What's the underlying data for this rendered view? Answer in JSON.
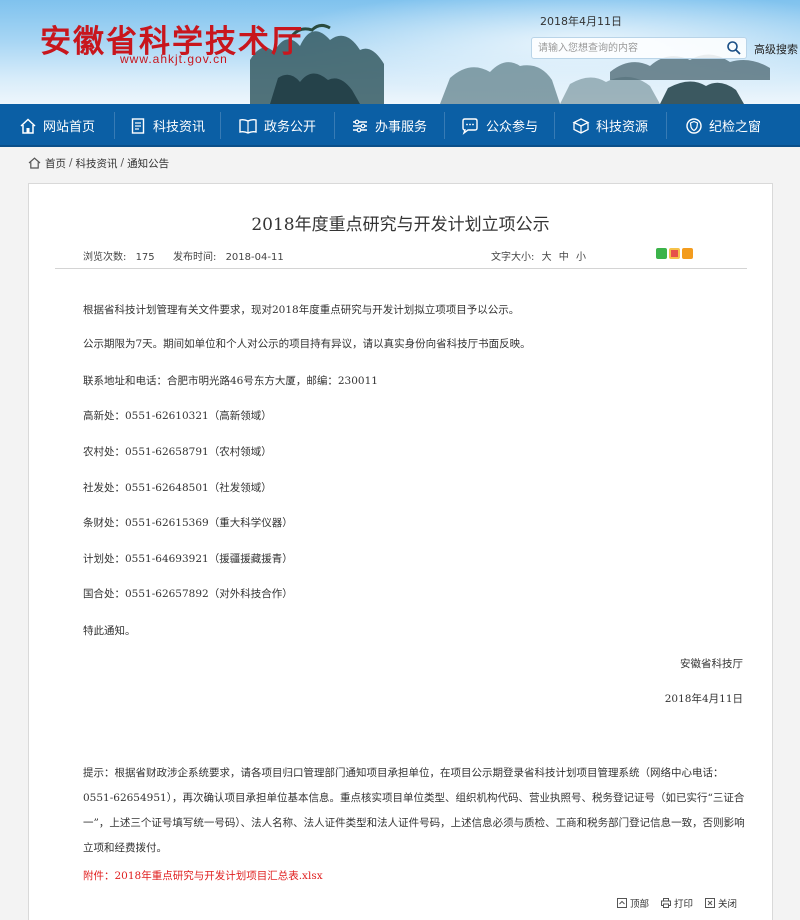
{
  "header": {
    "title": "安徽省科学技术厅",
    "url": "www.ahkjt.gov.cn",
    "date": "2018年4月11日",
    "search_placeholder": "请输入您想查询的内容",
    "advanced_search": "高级搜索"
  },
  "nav": {
    "items": [
      {
        "label": "网站首页",
        "icon": "home-icon"
      },
      {
        "label": "科技资讯",
        "icon": "news-icon"
      },
      {
        "label": "政务公开",
        "icon": "book-icon"
      },
      {
        "label": "办事服务",
        "icon": "service-icon"
      },
      {
        "label": "公众参与",
        "icon": "chat-icon"
      },
      {
        "label": "科技资源",
        "icon": "box-icon"
      },
      {
        "label": "纪检之窗",
        "icon": "shield-icon"
      }
    ]
  },
  "breadcrumb": [
    "首页",
    "科技资讯",
    "通知公告"
  ],
  "article": {
    "title": "2018年度重点研究与开发计划立项公示",
    "views_label": "浏览次数:",
    "views": "175",
    "pubtime_label": "发布时间:",
    "pubtime": "2018-04-11",
    "fontsize_label": "文字大小:",
    "fontsize_options": [
      "大",
      "中",
      "小"
    ],
    "paragraphs": [
      "根据省科技计划管理有关文件要求，现对2018年度重点研究与开发计划拟立项项目予以公示。",
      "公示期限为7天。期间如单位和个人对公示的项目持有异议，请以真实身份向省科技厅书面反映。",
      "联系地址和电话：合肥市明光路46号东方大厦，邮编：230011",
      "高新处：0551-62610321（高新领域）",
      "农村处：0551-62658791（农村领域）",
      "社发处：0551-62648501（社发领域）",
      "条财处：0551-62615369（重大科学仪器）",
      "计划处：0551-64693921（援疆援藏援青）",
      "国合处：0551-62657892（对外科技合作）",
      "特此通知。"
    ],
    "signature": "安徽省科技厅",
    "sign_date": "2018年4月11日",
    "notice": "提示：根据省财政涉企系统要求，请各项目归口管理部门通知项目承担单位，在项目公示期登录省科技计划项目管理系统（网络中心电话：0551-62654951），再次确认项目承担单位基本信息。重点核实项目单位类型、组织机构代码、营业执照号、税务登记证号（如已实行“三证合一”，上述三个证号填写统一号码）、法人名称、法人证件类型和法人证件号码，上述信息必须与质检、工商和税务部门登记信息一致，否则影响立项和经费拨付。",
    "attachment_prefix": "附件：",
    "attachment_link": "2018年重点研究与开发计划项目汇总表.xlsx"
  },
  "tools": {
    "top": "顶部",
    "print": "打印",
    "close": "关闭"
  },
  "colors": {
    "brand_red": "#c8161d",
    "nav_blue": "#0b5fa5",
    "attachment_red": "#e02020"
  }
}
